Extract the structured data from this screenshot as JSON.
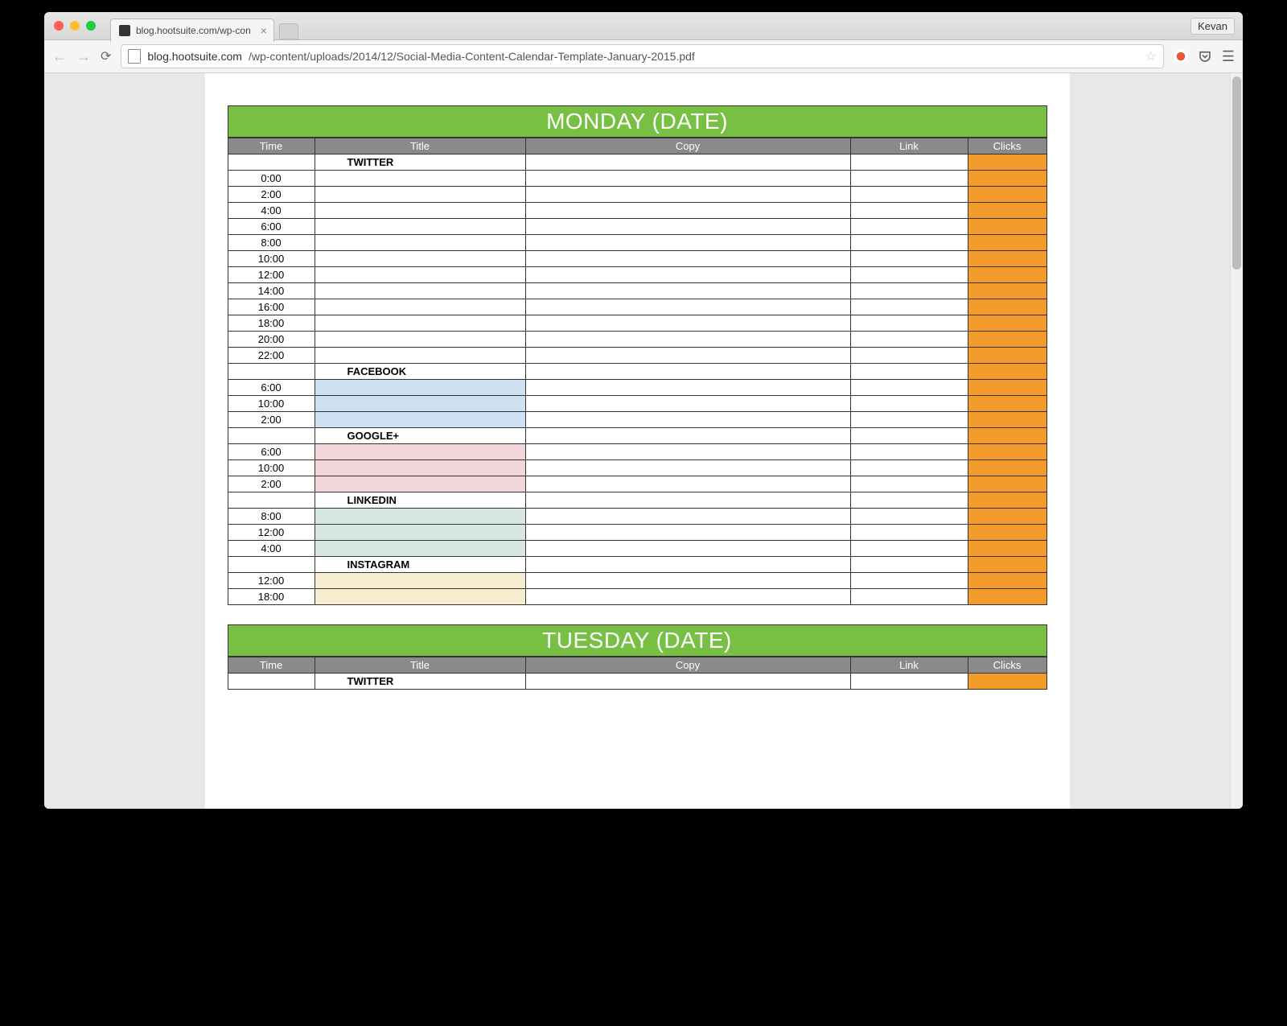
{
  "titlebar": {
    "tab_title": "blog.hootsuite.com/wp-con",
    "profile_name": "Kevan"
  },
  "urlbar": {
    "host": "blog.hootsuite.com",
    "path": "/wp-content/uploads/2014/12/Social-Media-Content-Calendar-Template-January-2015.pdf"
  },
  "headers": {
    "time": "Time",
    "title": "Title",
    "copy": "Copy",
    "link": "Link",
    "clicks": "Clicks"
  },
  "days": {
    "monday": "MONDAY (DATE)",
    "tuesday": "TUESDAY (DATE)"
  },
  "sections": {
    "twitter": "TWITTER",
    "facebook": "FACEBOOK",
    "googleplus": "GOOGLE+",
    "linkedin": "LINKEDIN",
    "instagram": "INSTAGRAM"
  },
  "times": {
    "twitter": [
      "0:00",
      "2:00",
      "4:00",
      "6:00",
      "8:00",
      "10:00",
      "12:00",
      "14:00",
      "16:00",
      "18:00",
      "20:00",
      "22:00"
    ],
    "facebook": [
      "6:00",
      "10:00",
      "2:00"
    ],
    "googleplus": [
      "6:00",
      "10:00",
      "2:00"
    ],
    "linkedin": [
      "8:00",
      "12:00",
      "4:00"
    ],
    "instagram": [
      "12:00",
      "18:00"
    ]
  }
}
